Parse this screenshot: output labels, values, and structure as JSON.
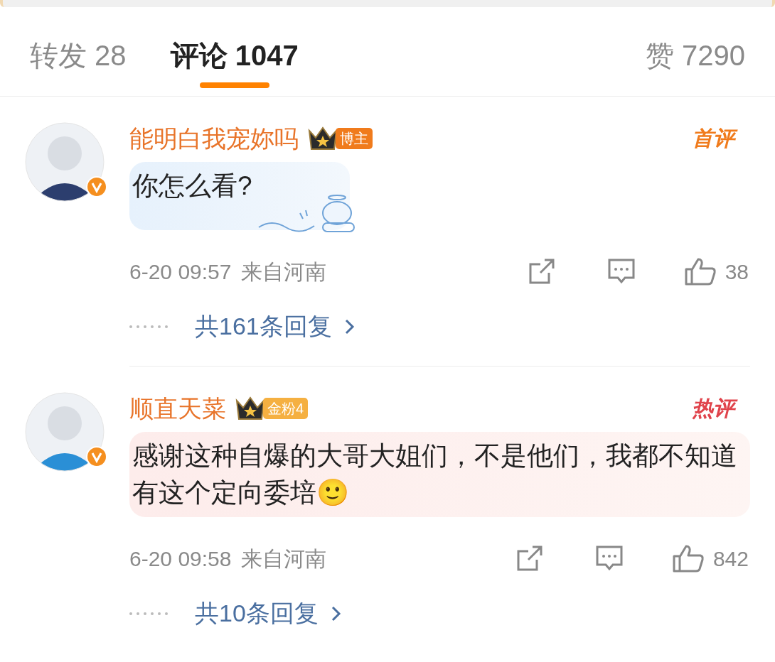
{
  "tabs": [
    {
      "label": "转发 28",
      "selected": false
    },
    {
      "label": "评论 1047",
      "selected": true
    },
    {
      "label": "赞 7290",
      "selected": false
    }
  ],
  "comments": [
    {
      "username": "能明白我宠妳吗",
      "badge": {
        "kind": "blogger",
        "label": "博主"
      },
      "tag": {
        "kind": "first",
        "label": "首评"
      },
      "text": "你怎么看?",
      "sticker": true,
      "time": "6-20 09:57",
      "location": "来自河南",
      "likes": "38",
      "replies": "共161条回复"
    },
    {
      "username": "顺直天菜",
      "badge": {
        "kind": "fan",
        "label": "金粉4"
      },
      "tag": {
        "kind": "hot",
        "label": "热评"
      },
      "text": "感谢这种自爆的大哥大姐们，不是他们，我都不知道有这个定向委培🙂",
      "sticker": false,
      "time": "6-20 09:58",
      "location": "来自河南",
      "likes": "842",
      "replies": "共10条回复"
    }
  ]
}
